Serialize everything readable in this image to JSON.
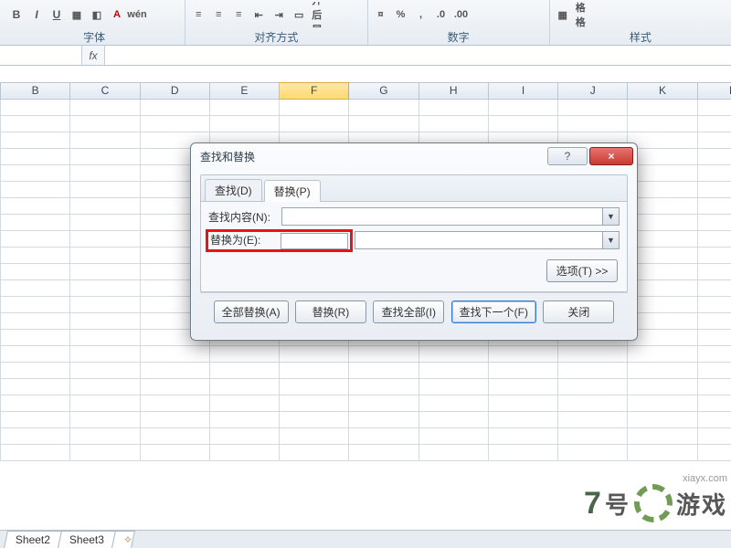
{
  "ribbon": {
    "groups": {
      "font": {
        "label": "字体"
      },
      "align": {
        "label": "对齐方式",
        "merge_label": "合并后居中"
      },
      "number": {
        "label": "数字"
      },
      "style": {
        "label": "样式",
        "fmt_label": "表格格式"
      }
    },
    "percent": "%",
    "comma": ",",
    "decimals_inc": ".0",
    "decimals_dec": ".00"
  },
  "formula_bar": {
    "fx": "fx"
  },
  "columns": [
    "B",
    "C",
    "D",
    "E",
    "F",
    "G",
    "H",
    "I",
    "J",
    "K",
    "L"
  ],
  "selected_column": "F",
  "sheet_tabs": [
    "Sheet2",
    "Sheet3"
  ],
  "dialog": {
    "title": "查找和替换",
    "tabs": {
      "find": "查找(D)",
      "replace": "替换(P)"
    },
    "find_label": "查找内容(N):",
    "replace_label": "替换为(E):",
    "options": "选项(T) >>",
    "buttons": {
      "replace_all": "全部替换(A)",
      "replace": "替换(R)",
      "find_all": "查找全部(I)",
      "find_next": "查找下一个(F)",
      "close": "关闭"
    }
  },
  "watermark": {
    "seven": "7",
    "brand_suffix": "号",
    "cn": "游戏",
    "url": "xiayx.com"
  }
}
